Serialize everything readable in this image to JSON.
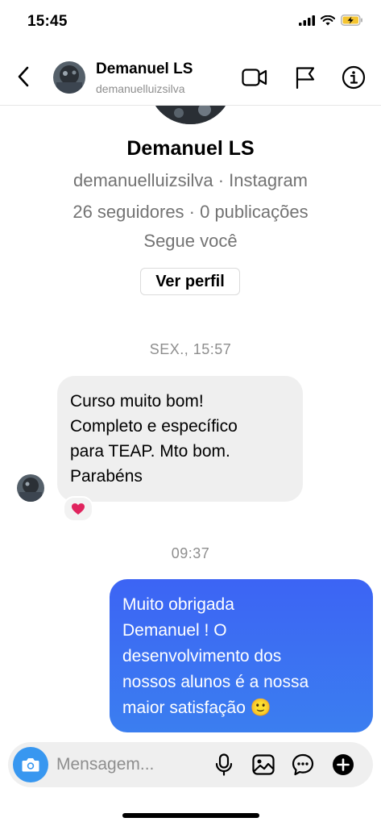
{
  "status_bar": {
    "time": "15:45"
  },
  "header": {
    "back_icon": "chevron-left-icon",
    "name": "Demanuel LS",
    "username": "demanuelluizsilva",
    "video_icon": "video-camera-icon",
    "flag_icon": "flag-icon",
    "info_icon": "info-icon"
  },
  "profile": {
    "name": "Demanuel LS",
    "subtitle": "demanuelluizsilva · Instagram",
    "stats": "26 seguidores · 0 publicações",
    "follow_status": "Segue você",
    "button_label": "Ver perfil"
  },
  "messages": [
    {
      "timestamp": "SEX., 15:57",
      "direction": "incoming",
      "lines": [
        "Curso muito bom!",
        "Completo e específico",
        "para TEAP. Mto bom.",
        "Parabéns"
      ],
      "reaction": "❤️"
    },
    {
      "timestamp": "09:37",
      "direction": "outgoing",
      "lines": [
        "Muito obrigada",
        "Demanuel ! O",
        "desenvolvimento dos",
        "nossos alunos é a nossa",
        "maior satisfação 🙂"
      ]
    }
  ],
  "composer": {
    "placeholder": "Mensagem...",
    "icons": [
      "camera-icon",
      "microphone-icon",
      "gallery-icon",
      "sticker-icon",
      "add-icon"
    ]
  },
  "colors": {
    "outgoing_bubble": "#3b6df2",
    "incoming_bubble": "#efefef",
    "camera_button": "#3897f0",
    "muted_text": "#8e8e8e"
  }
}
